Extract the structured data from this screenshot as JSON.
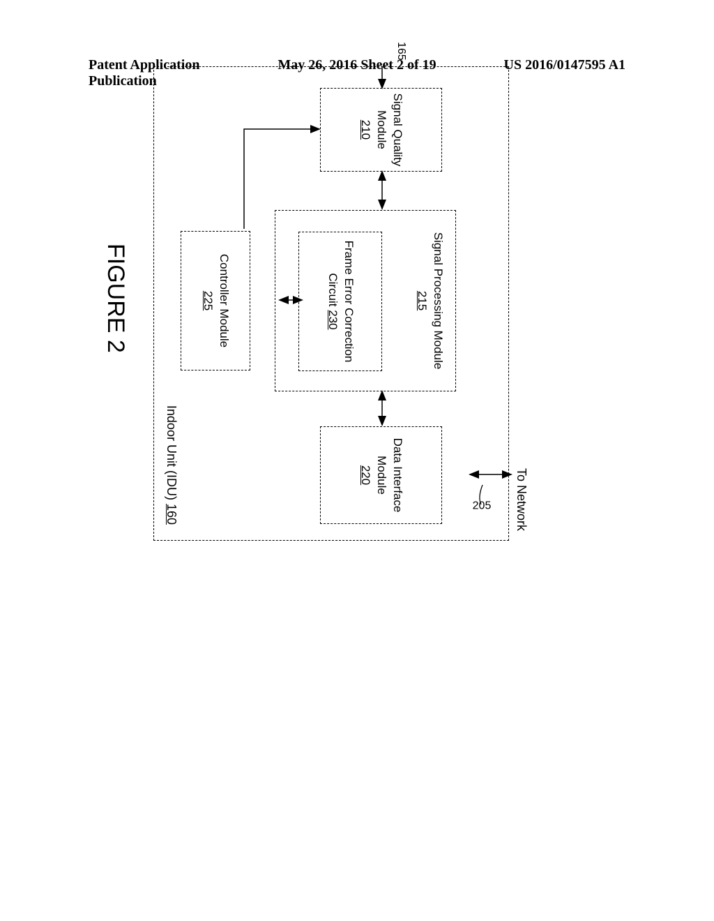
{
  "header": {
    "left": "Patent Application Publication",
    "center": "May 26, 2016  Sheet 2 of 19",
    "right": "US 2016/0147595 A1"
  },
  "diagram": {
    "network_label": "To Network",
    "idu_label_text": "Indoor Unit (IDU) ",
    "idu_ref": "160",
    "sq": {
      "line1": "Signal Quality",
      "line2": "Module",
      "ref": "210"
    },
    "sp": {
      "line1": "Signal Processing Module",
      "ref": "215"
    },
    "fec": {
      "line1": "Frame Error Correction",
      "line2": "Circuit ",
      "ref": "230"
    },
    "di": {
      "line1": "Data Interface",
      "line2": "Module",
      "ref": "220"
    },
    "ctrl": {
      "line1": "Controller Module",
      "ref": "225"
    },
    "ref_165": "165",
    "ref_205": "205"
  },
  "figure_caption": "FIGURE 2"
}
